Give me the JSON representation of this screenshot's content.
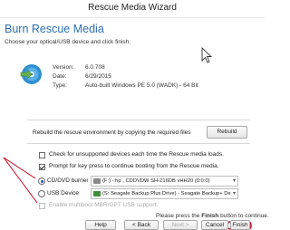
{
  "window": {
    "title": "Rescue Media Wizard"
  },
  "header": {
    "title": "Burn Rescue Media",
    "subtitle": "Choose your optical/USB device and click finish."
  },
  "info": {
    "version_label": "Version:",
    "version_value": "6.0.708",
    "date_label": "Date:",
    "date_value": "6/29/2015",
    "type_label": "Type:",
    "type_value": "Auto-built Windows PE 5.0 (WADK) - 64 Bit"
  },
  "rebuild": {
    "text": "Rebuild the rescue environment by copying the required files",
    "button_label": "Rebuild"
  },
  "options": {
    "check_unsupported": {
      "label": "Check for unsupported devices each time the Rescue media loads.",
      "checked": false
    },
    "prompt_keypress": {
      "label": "Prompt for key press to continue booting from the Rescue media.",
      "checked": true
    },
    "multiboot": {
      "label": "Enable multiboot MBR/GPT USB support.",
      "checked": false,
      "disabled": true
    }
  },
  "devices": {
    "cd_dvd_label": "CD/DVD burner",
    "cd_dvd_selected": true,
    "cd_dvd_value": "(F:) - hp   , CDDVDW SH-216DB  vHH20 (0:0:0)",
    "usb_label": "USB Device",
    "usb_selected": false,
    "usb_value": "(S: Seagate Backup Plus Drive) - Seagate Backup+  De"
  },
  "footer": {
    "prefix": "Please press the ",
    "bold": "Finish",
    "suffix": " button to continue."
  },
  "buttons": {
    "help": "Help",
    "back": "< Back",
    "next": "Next >",
    "cancel": "Cancel",
    "finish": "Finish"
  },
  "colors": {
    "header_blue": "#2a6fb5",
    "annotation_red": "#c8001e"
  }
}
